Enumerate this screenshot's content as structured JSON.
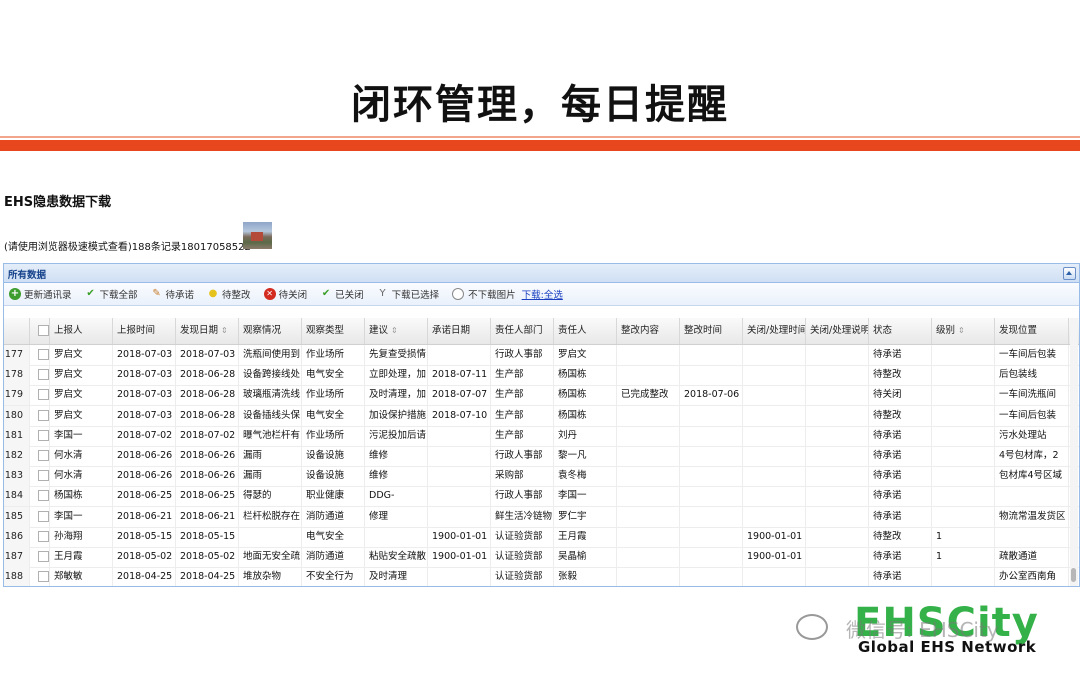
{
  "slide": {
    "title": "闭环管理，每日提醒"
  },
  "page": {
    "heading": "EHS隐患数据下载",
    "note": "(请使用浏览器极速模式查看)188条记录18017058522"
  },
  "panel": {
    "title": "所有数据"
  },
  "toolbar": {
    "update": "更新通讯录",
    "download_all": "下载全部",
    "pending_commit": "待承诺",
    "pending_fix": "待整改",
    "pending_close": "待关闭",
    "closed": "已关闭",
    "download_selected": "下载已选择",
    "no_images": "不下载图片",
    "download_link": "下载:全选"
  },
  "columns": [
    "上报人",
    "上报时间",
    "发现日期",
    "观察情况",
    "观察类型",
    "建议",
    "承诺日期",
    "责任人部门",
    "责任人",
    "整改内容",
    "整改时间",
    "关闭/处理时间",
    "关闭/处理说明",
    "状态",
    "级别",
    "发现位置"
  ],
  "rows": [
    [
      "177",
      "罗启文",
      "2018-07-03",
      "2018-07-03",
      "洗瓶间使用到",
      "作业场所",
      "先复查受损情",
      "",
      "行政人事部",
      "罗启文",
      "",
      "",
      "",
      "",
      "待承诺",
      "",
      "一车间后包装"
    ],
    [
      "178",
      "罗启文",
      "2018-07-03",
      "2018-06-28",
      "设备跨接线处",
      "电气安全",
      "立即处理，加",
      "2018-07-11",
      "生产部",
      "杨国栋",
      "",
      "",
      "",
      "",
      "待整改",
      "",
      "后包装线"
    ],
    [
      "179",
      "罗启文",
      "2018-07-03",
      "2018-06-28",
      "玻璃瓶清洗线",
      "作业场所",
      "及时清理，加",
      "2018-07-07",
      "生产部",
      "杨国栋",
      "已完成整改",
      "2018-07-06",
      "",
      "",
      "待关闭",
      "",
      "一车间洗瓶间"
    ],
    [
      "180",
      "罗启文",
      "2018-07-03",
      "2018-06-28",
      "设备插线头保",
      "电气安全",
      "加设保护措施",
      "2018-07-10",
      "生产部",
      "杨国栋",
      "",
      "",
      "",
      "",
      "待整改",
      "",
      "一车间后包装"
    ],
    [
      "181",
      "李国一",
      "2018-07-02",
      "2018-07-02",
      "曝气池栏杆有",
      "作业场所",
      "污泥投加后请",
      "",
      "生产部",
      "刘丹",
      "",
      "",
      "",
      "",
      "待承诺",
      "",
      "污水处理站"
    ],
    [
      "182",
      "何水清",
      "2018-06-26",
      "2018-06-26",
      "漏雨",
      "设备设施",
      "维修",
      "",
      "行政人事部",
      "黎一凡",
      "",
      "",
      "",
      "",
      "待承诺",
      "",
      "4号包材库，2"
    ],
    [
      "183",
      "何水清",
      "2018-06-26",
      "2018-06-26",
      "漏雨",
      "设备设施",
      "维修",
      "",
      "采购部",
      "袁冬梅",
      "",
      "",
      "",
      "",
      "待承诺",
      "",
      "包材库4号区域"
    ],
    [
      "184",
      "杨国栋",
      "2018-06-25",
      "2018-06-25",
      "得瑟的",
      "职业健康",
      "DDG-",
      "",
      "行政人事部",
      "李国一",
      "",
      "",
      "",
      "",
      "待承诺",
      "",
      ""
    ],
    [
      "185",
      "李国一",
      "2018-06-21",
      "2018-06-21",
      "栏杆松脱存在",
      "消防通道",
      "修理",
      "",
      "鲜生活冷链物",
      "罗仁宇",
      "",
      "",
      "",
      "",
      "待承诺",
      "",
      "物流常温发货区"
    ],
    [
      "186",
      "孙海翔",
      "2018-05-15",
      "2018-05-15",
      "",
      "电气安全",
      "",
      "1900-01-01",
      "认证验货部",
      "王月霞",
      "",
      "",
      "1900-01-01",
      "",
      "待整改",
      "1",
      ""
    ],
    [
      "187",
      "王月霞",
      "2018-05-02",
      "2018-05-02",
      "地面无安全疏",
      "消防通道",
      "粘贴安全疏散",
      "1900-01-01",
      "认证验货部",
      "吴晶榆",
      "",
      "",
      "1900-01-01",
      "",
      "待承诺",
      "1",
      "疏散通道"
    ],
    [
      "188",
      "郑敏敏",
      "2018-04-25",
      "2018-04-25",
      "堆放杂物",
      "不安全行为",
      "及时清理",
      "",
      "认证验货部",
      "张毅",
      "",
      "",
      "",
      "",
      "待承诺",
      "",
      "办公室西南角"
    ]
  ],
  "watermark": {
    "logo": "EHSCity",
    "subtitle": "Global EHS Network",
    "wechat": "微信号: EHSCity"
  }
}
